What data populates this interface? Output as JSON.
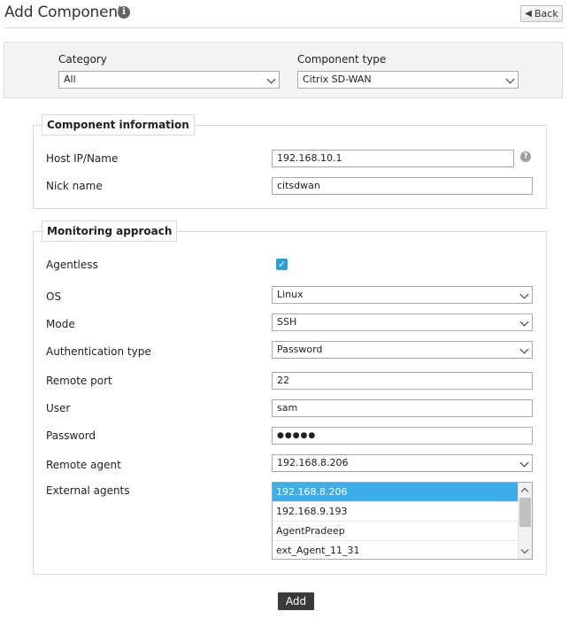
{
  "header": {
    "title": "Add Component",
    "back_label": "Back"
  },
  "filter": {
    "category_label": "Category",
    "category_value": "All",
    "component_type_label": "Component type",
    "component_type_value": "Citrix SD-WAN"
  },
  "component_info": {
    "legend": "Component information",
    "host_label": "Host IP/Name",
    "host_value": "192.168.10.1",
    "nick_label": "Nick name",
    "nick_value": "citsdwan"
  },
  "monitoring": {
    "legend": "Monitoring approach",
    "agentless_label": "Agentless",
    "agentless_checked": true,
    "os_label": "OS",
    "os_value": "Linux",
    "mode_label": "Mode",
    "mode_value": "SSH",
    "auth_label": "Authentication type",
    "auth_value": "Password",
    "port_label": "Remote port",
    "port_value": "22",
    "user_label": "User",
    "user_value": "sam",
    "password_label": "Password",
    "password_mask": "●●●●●",
    "remote_agent_label": "Remote agent",
    "remote_agent_value": "192.168.8.206",
    "external_agents_label": "External agents",
    "external_agents": [
      {
        "name": "192.168.8.206",
        "selected": true
      },
      {
        "name": "192.168.9.193",
        "selected": false
      },
      {
        "name": "AgentPradeep",
        "selected": false
      },
      {
        "name": "ext_Agent_11_31",
        "selected": false
      }
    ]
  },
  "actions": {
    "add_label": "Add"
  },
  "colors": {
    "accent": "#3daee9",
    "checkbox": "#2a9fd8",
    "add_button": "#3a3a3a"
  }
}
